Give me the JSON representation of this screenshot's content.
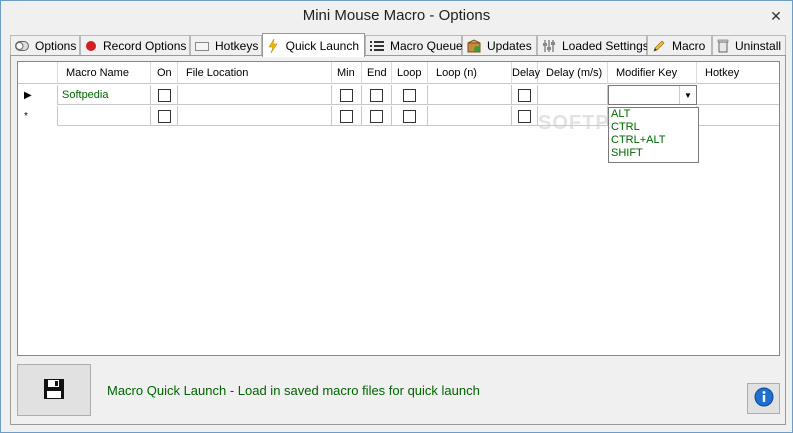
{
  "window": {
    "title": "Mini Mouse Macro - Options",
    "close_glyph": "✕"
  },
  "tabs": [
    {
      "label": "Options",
      "icon": "toggle-icon"
    },
    {
      "label": "Record Options",
      "icon": "record-icon"
    },
    {
      "label": "Hotkeys",
      "icon": "keyboard-icon"
    },
    {
      "label": "Quick Launch",
      "icon": "lightning-icon",
      "active": true
    },
    {
      "label": "Macro Queue",
      "icon": "list-icon"
    },
    {
      "label": "Updates",
      "icon": "package-icon"
    },
    {
      "label": "Loaded Settings",
      "icon": "sliders-icon"
    },
    {
      "label": "Macro",
      "icon": "pencil-icon"
    },
    {
      "label": "Uninstall",
      "icon": "trash-icon"
    }
  ],
  "grid": {
    "columns": [
      "Macro Name",
      "On",
      "File Location",
      "Min",
      "End",
      "Loop",
      "Loop (n)",
      "Delay",
      "Delay (m/s)",
      "Modifier Key",
      "Hotkey"
    ],
    "rows": [
      {
        "marker": "▶",
        "macro_name": "Softpedia"
      },
      {
        "marker": "*",
        "macro_name": ""
      }
    ]
  },
  "dropdown": {
    "options": [
      "ALT",
      "CTRL",
      "CTRL+ALT",
      "SHIFT"
    ]
  },
  "watermark": "SOFTPEDIA",
  "footer": {
    "message": "Macro Quick Launch - Load in saved macro files for quick launch"
  },
  "colors": {
    "accent_text": "#006400",
    "border": "#6d9cc9"
  }
}
